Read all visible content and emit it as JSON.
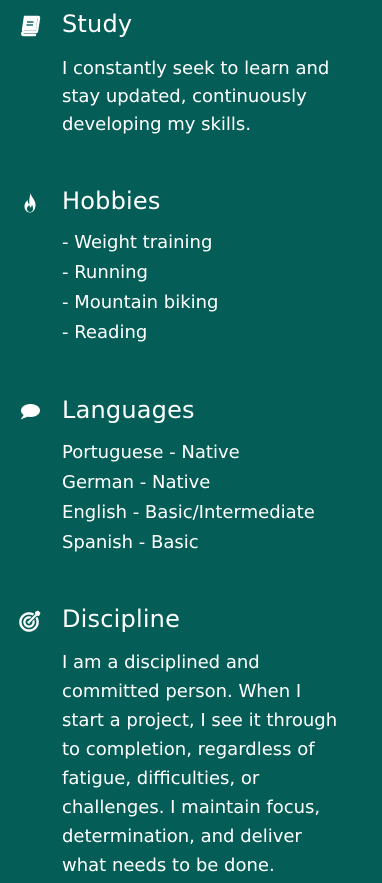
{
  "sections": [
    {
      "title": "Study",
      "icon": "book-icon",
      "text": "I constantly seek to learn and\nstay updated, continuously\ndeveloping my skills."
    },
    {
      "title": "Hobbies",
      "icon": "fire-icon",
      "items": [
        "- Weight training",
        "- Running",
        "- Mountain biking",
        "- Reading"
      ]
    },
    {
      "title": "Languages",
      "icon": "comment-icon",
      "items": [
        "Portuguese - Native",
        "German - Native",
        "English - Basic/Intermediate",
        "Spanish - Basic"
      ]
    },
    {
      "title": "Discipline",
      "icon": "target-icon",
      "text": "I am a disciplined and\ncommitted person. When I\nstart a project, I see it through\nto completion, regardless of\nfatigue, difficulties, or\nchallenges. I maintain focus,\ndetermination, and deliver\nwhat needs to be done."
    }
  ],
  "colors": {
    "background": "#045e57",
    "text": "#ffffff"
  }
}
